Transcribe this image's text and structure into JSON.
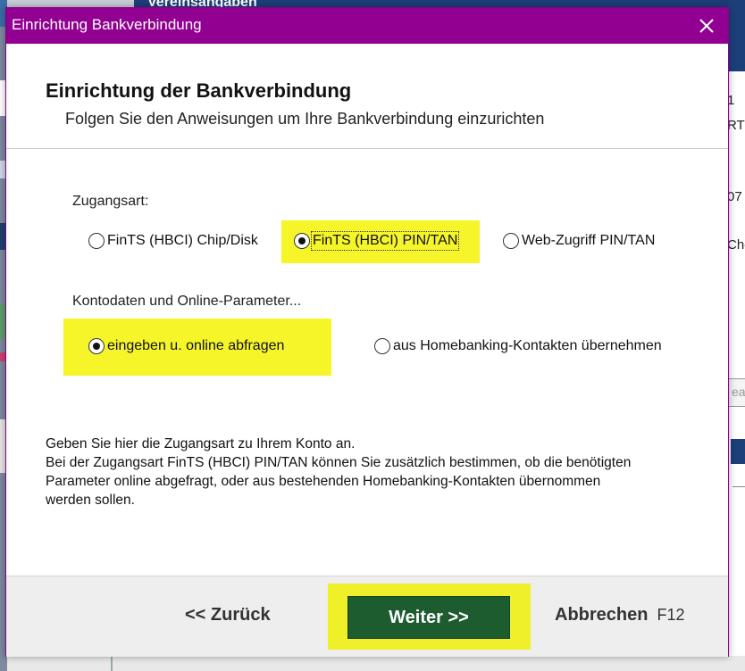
{
  "background": {
    "top_text": "Vereinsangaben",
    "right_fragments": [
      "1",
      "RT",
      "07",
      "Che"
    ],
    "right_input_fragment": "ea"
  },
  "dialog": {
    "title": "Einrichtung Bankverbindung",
    "close_label": "×",
    "header": {
      "title": "Einrichtung der Bankverbindung",
      "subtitle": "Folgen Sie den Anweisungen um Ihre Bankverbindung einzurichten"
    },
    "access_type": {
      "label": "Zugangsart:",
      "options": [
        {
          "label": "FinTS (HBCI) Chip/Disk",
          "selected": false
        },
        {
          "label": "FinTS (HBCI) PIN/TAN",
          "selected": true
        },
        {
          "label": "Web-Zugriff PIN/TAN",
          "selected": false
        }
      ]
    },
    "account_data": {
      "label": "Kontodaten und Online-Parameter...",
      "options": [
        {
          "label": "eingeben u. online abfragen",
          "selected": true
        },
        {
          "label": "aus Homebanking-Kontakten übernehmen",
          "selected": false
        }
      ]
    },
    "info_lines": [
      "Geben Sie hier die Zugangsart zu Ihrem Konto an.",
      "Bei der Zugangsart FinTS (HBCI) PIN/TAN können Sie zusätzlich bestimmen, ob die benötigten",
      "Parameter online abgefragt, oder aus bestehenden Homebanking-Kontakten übernommen",
      "werden sollen."
    ],
    "footer": {
      "back_label": "<< Zurück",
      "next_label": "Weiter >>",
      "cancel_label": "Abbrechen",
      "cancel_shortcut": "F12"
    },
    "colors": {
      "titlebar": "#910091",
      "highlight": "#f5f52a",
      "next_button": "#1d5c2f"
    }
  }
}
